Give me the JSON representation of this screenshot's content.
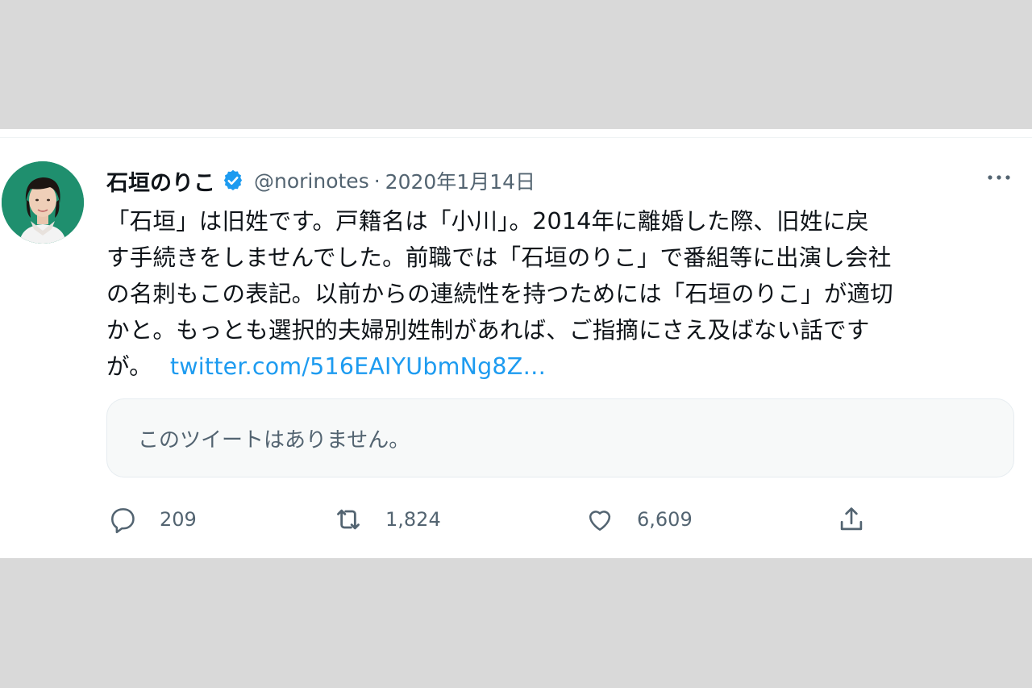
{
  "tweet": {
    "display_name": "石垣のりこ",
    "handle": "@norinotes",
    "separator": "·",
    "date": "2020年1月14日",
    "text_lines": [
      "「石垣」は旧姓です。戸籍名は「小川」。2014年に離婚した際、旧姓に戻",
      "す手続きをしませんでした。前職では「石垣のりこ」で番組等に出演し会社",
      "の名刺もこの表記。以前からの連続性を持つためには「石垣のりこ」が適切",
      "かと。もっとも選択的夫婦別姓制があれば、ご指摘にさえ及ばない話です"
    ],
    "last_line_text": "が。",
    "link": "twitter.com/516EAIYUbmNg8Z…",
    "quote_unavailable": "このツイートはありません。",
    "metrics": {
      "replies": "209",
      "retweets": "1,824",
      "likes": "6,609"
    }
  },
  "icons": {
    "verified": "verified-badge-icon",
    "more": "more-dots-icon",
    "reply": "reply-icon",
    "retweet": "retweet-icon",
    "like": "heart-icon",
    "share": "share-icon"
  },
  "colors": {
    "accent": "#1d9bf0",
    "text": "#0f1419",
    "muted": "#536471",
    "background": "#d9d9d9"
  }
}
